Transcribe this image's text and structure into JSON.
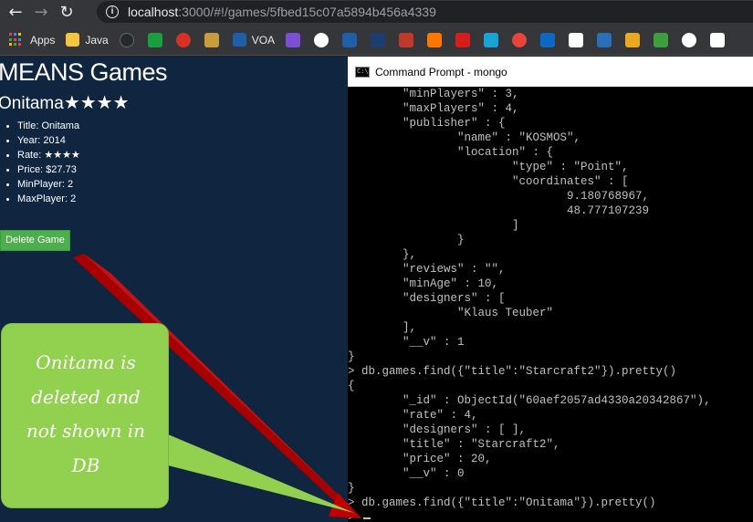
{
  "browser": {
    "back_glyph": "←",
    "forward_glyph": "→",
    "reload_glyph": "↻",
    "info_glyph": "i",
    "url_host": "localhost",
    "url_rest": ":3000/#!/games/5fbed15c07a5894b456a4339",
    "icons": [
      "arrow-left-icon",
      "arrow-right-icon",
      "reload-icon",
      "info-icon"
    ]
  },
  "bookmarks": {
    "apps_label": "Apps",
    "java_label": "Java",
    "voa_label": "VOA",
    "icon_colors": [
      "#24292e",
      "#1a9e3f",
      "#d93025",
      "#c69c3d",
      "#1f5fa8",
      "#7b4fd6",
      "#ffffff",
      "#1f5fa8",
      "#1d3d70",
      "#c0392b",
      "#ff7700",
      "#d81b1b",
      "#1ba3d6",
      "#e8443a",
      "#0f67c4",
      "#ffffff",
      "#2a6fb8",
      "#e9a820",
      "#3c9e3c",
      "#ffffff",
      "#ffffff"
    ]
  },
  "page": {
    "site_title": "MEANS Games",
    "game_title": "Onitama",
    "game_stars": "★★★★",
    "details": [
      {
        "label": "Title: Onitama"
      },
      {
        "label": "Year: 2014"
      },
      {
        "label": "Rate: ",
        "stars": "★★★★"
      },
      {
        "label": "Price: $27.73"
      },
      {
        "label": "MinPlayer: 2"
      },
      {
        "label": "MaxPlayer: 2"
      }
    ],
    "delete_label": "Delete Game"
  },
  "callout": {
    "lines": [
      "Onitama is",
      "deleted and",
      "not shown in",
      "DB"
    ],
    "colors": {
      "fill": "#92d050",
      "arrow": "#c00000"
    }
  },
  "console": {
    "window_title": "Command Prompt - mongo",
    "output": "        \"minPlayers\" : 3,\n        \"maxPlayers\" : 4,\n        \"publisher\" : {\n                \"name\" : \"KOSMOS\",\n                \"location\" : {\n                        \"type\" : \"Point\",\n                        \"coordinates\" : [\n                                9.180768967,\n                                48.777107239\n                        ]\n                }\n        },\n        \"reviews\" : \"\",\n        \"minAge\" : 10,\n        \"designers\" : [\n                \"Klaus Teuber\"\n        ],\n        \"__v\" : 1\n}\n> db.games.find({\"title\":\"Starcraft2\"}).pretty()\n{\n        \"_id\" : ObjectId(\"60aef2057ad4330a20342867\"),\n        \"rate\" : 4,\n        \"designers\" : [ ],\n        \"title\" : \"Starcraft2\",\n        \"price\" : 20,\n        \"__v\" : 0\n}\n> db.games.find({\"title\":\"Onitama\"}).pretty()\n>"
  }
}
